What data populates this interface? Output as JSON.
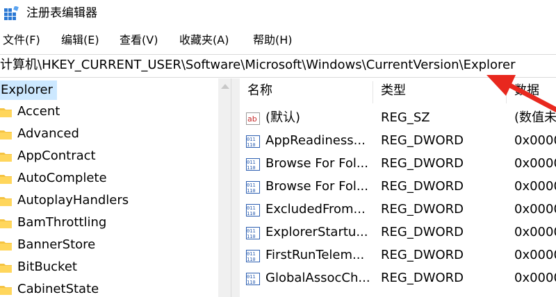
{
  "window": {
    "title": "注册表编辑器"
  },
  "menu": [
    "文件(F)",
    "编辑(E)",
    "查看(V)",
    "收藏夹(A)",
    "帮助(H)"
  ],
  "address": {
    "path": "计算机\\HKEY_CURRENT_USER\\Software\\Microsoft\\Windows\\CurrentVersion\\Explorer"
  },
  "tree": {
    "selected": "Explorer",
    "children": [
      "Accent",
      "Advanced",
      "AppContract",
      "AutoComplete",
      "AutoplayHandlers",
      "BamThrottling",
      "BannerStore",
      "BitBucket",
      "CabinetState"
    ]
  },
  "list": {
    "columns": [
      "名称",
      "类型",
      "数据"
    ],
    "rows": [
      {
        "name": "(默认)",
        "type": "REG_SZ",
        "data": "(数值未",
        "icon": "string-value-icon"
      },
      {
        "name": "AppReadiness...",
        "type": "REG_DWORD",
        "data": "0x0000",
        "icon": "binary-value-icon"
      },
      {
        "name": "Browse For Fol...",
        "type": "REG_DWORD",
        "data": "0x0000",
        "icon": "binary-value-icon"
      },
      {
        "name": "Browse For Fol...",
        "type": "REG_DWORD",
        "data": "0x0000",
        "icon": "binary-value-icon"
      },
      {
        "name": "ExcludedFrom...",
        "type": "REG_DWORD",
        "data": "0x0000",
        "icon": "binary-value-icon"
      },
      {
        "name": "ExplorerStartu...",
        "type": "REG_DWORD",
        "data": "0x0000",
        "icon": "binary-value-icon"
      },
      {
        "name": "FirstRunTelem...",
        "type": "REG_DWORD",
        "data": "0x0000",
        "icon": "binary-value-icon"
      },
      {
        "name": "GlobalAssocCh...",
        "type": "REG_DWORD",
        "data": "0x0000",
        "icon": "binary-value-icon"
      }
    ]
  },
  "colors": {
    "selection": "#cce8ff",
    "folder": "#f5c342",
    "annotation_arrow": "#e8281e"
  }
}
